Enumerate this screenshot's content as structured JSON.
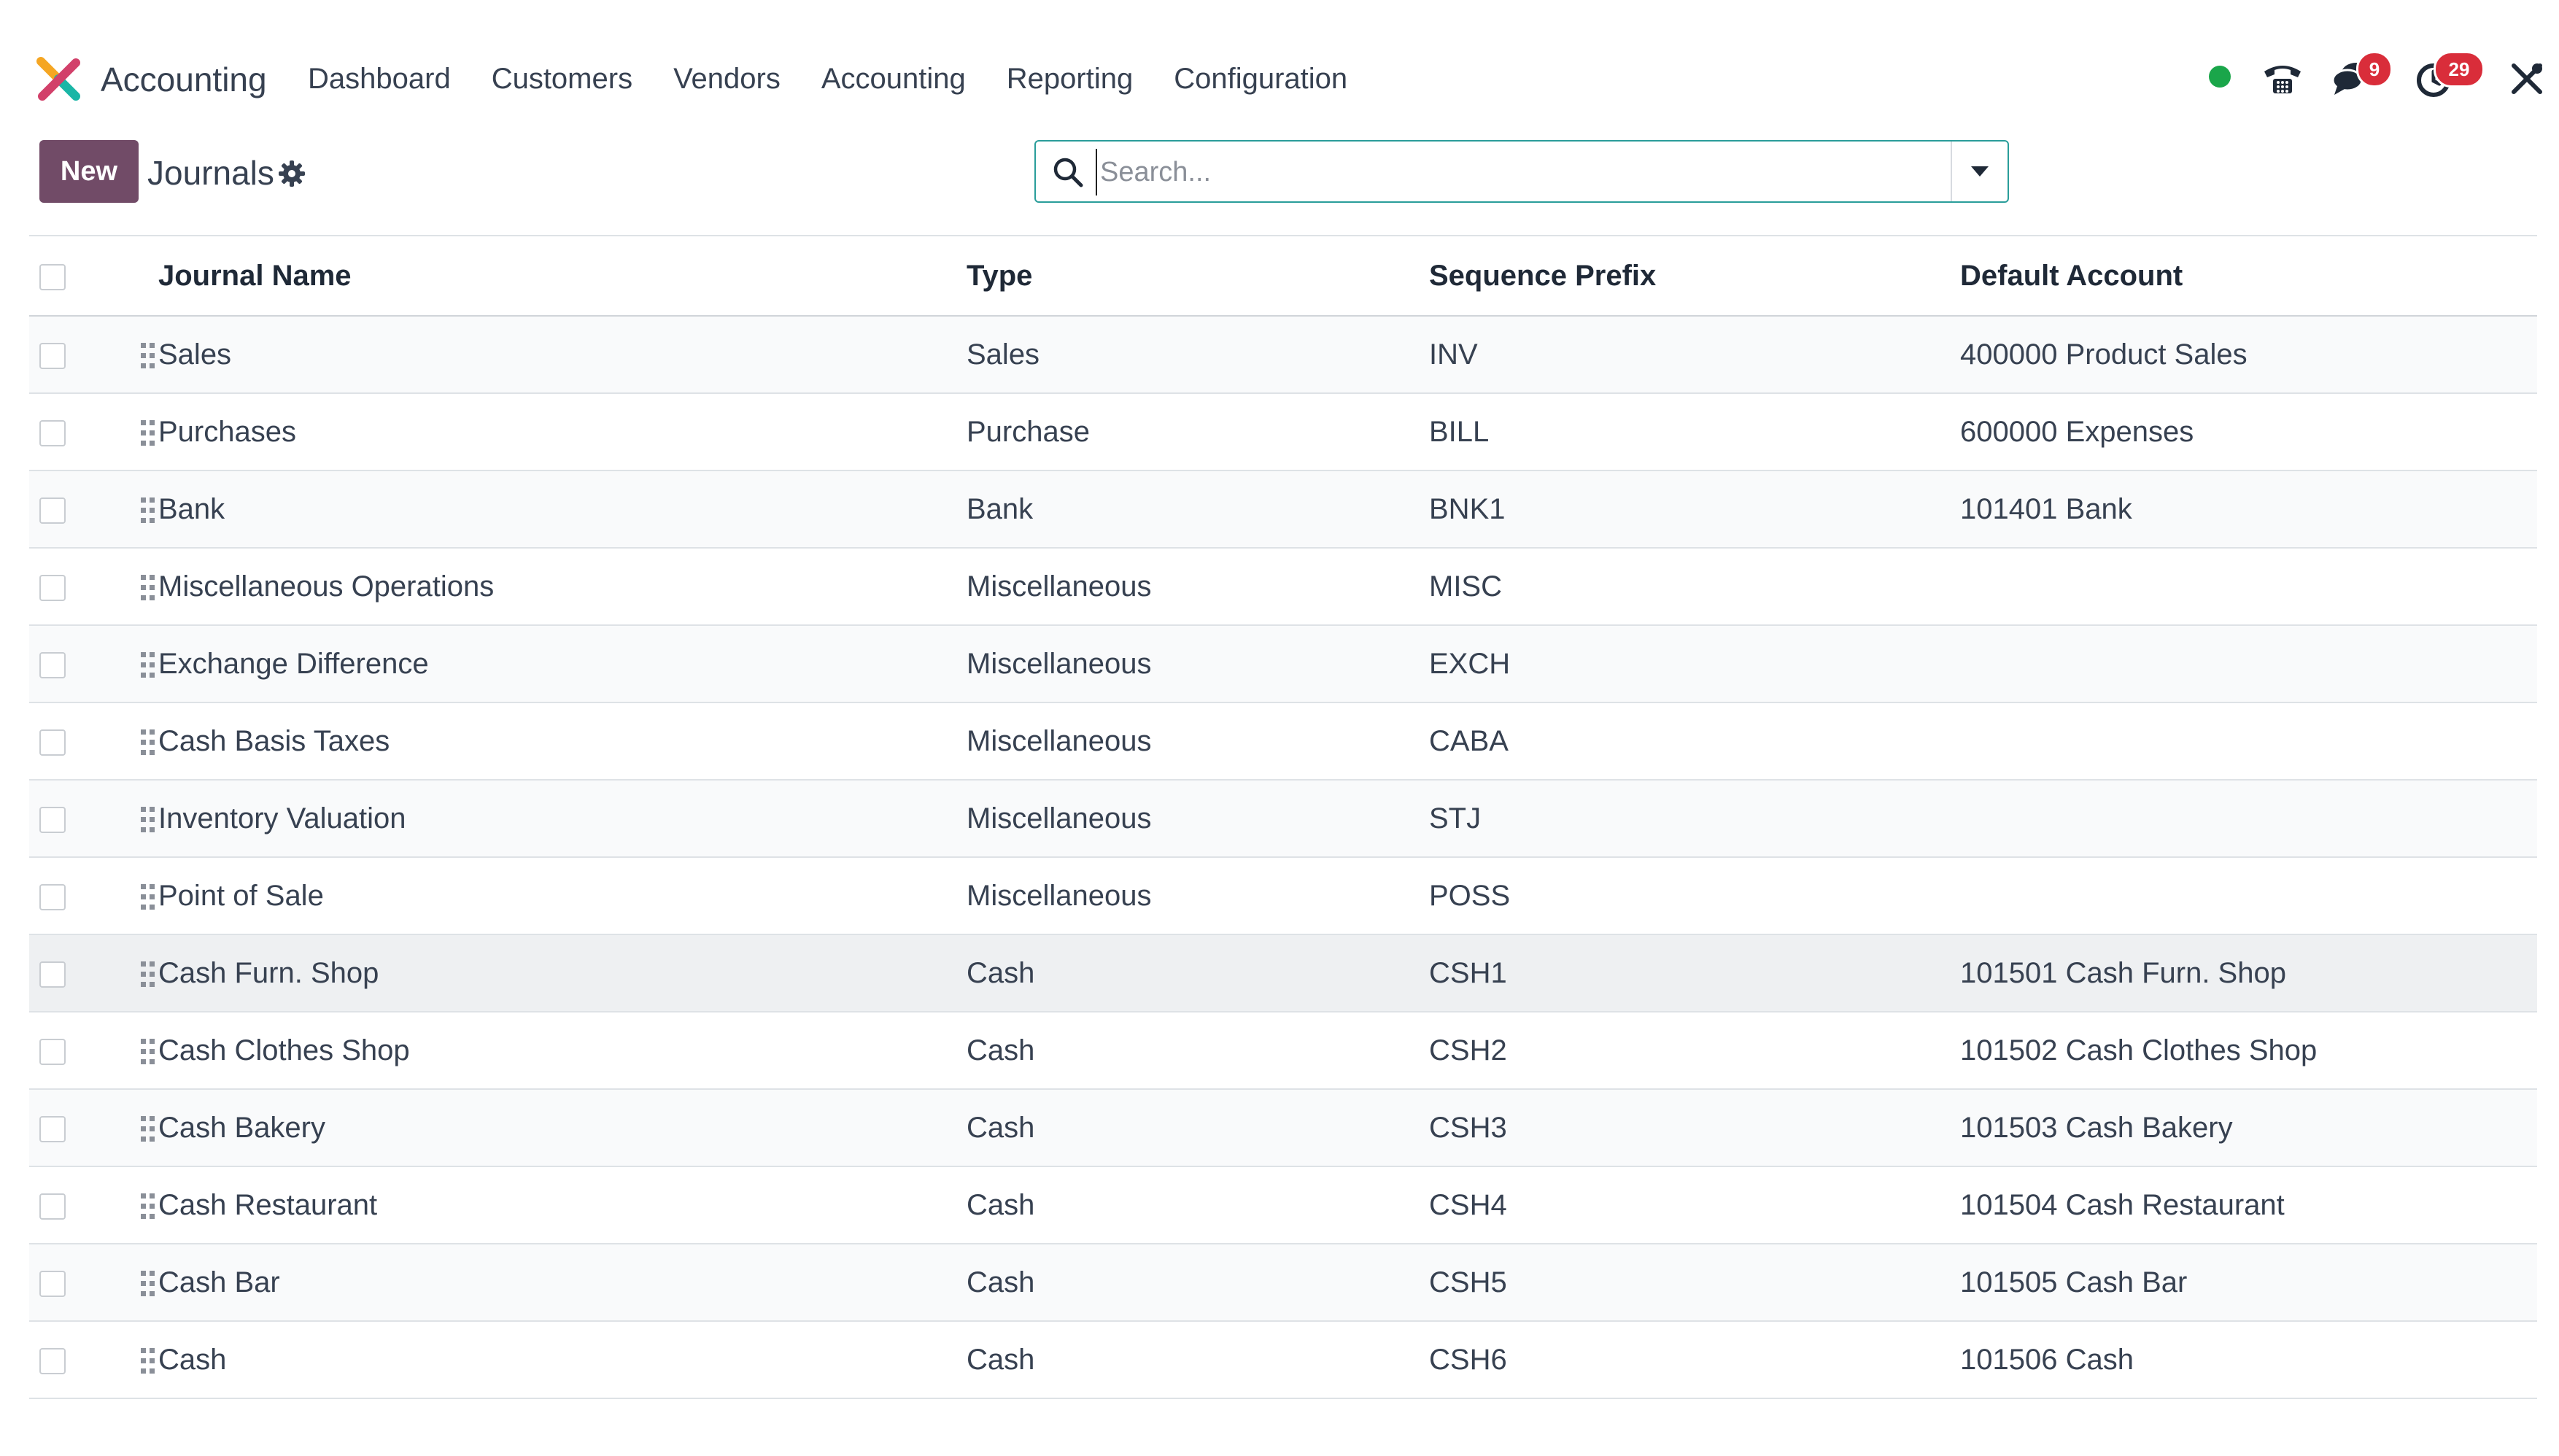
{
  "navbar": {
    "app_name": "Accounting",
    "menu": [
      "Dashboard",
      "Customers",
      "Vendors",
      "Accounting",
      "Reporting",
      "Configuration"
    ],
    "messages_count": "9",
    "activities_count": "29",
    "presence_color": "#1aa64a"
  },
  "control_panel": {
    "new_label": "New",
    "breadcrumb": "Journals",
    "search_placeholder": "Search..."
  },
  "table": {
    "columns": [
      "Journal Name",
      "Type",
      "Sequence Prefix",
      "Default Account"
    ],
    "rows": [
      {
        "name": "Sales",
        "type": "Sales",
        "prefix": "INV",
        "account": "400000 Product Sales"
      },
      {
        "name": "Purchases",
        "type": "Purchase",
        "prefix": "BILL",
        "account": "600000 Expenses"
      },
      {
        "name": "Bank",
        "type": "Bank",
        "prefix": "BNK1",
        "account": "101401 Bank"
      },
      {
        "name": "Miscellaneous Operations",
        "type": "Miscellaneous",
        "prefix": "MISC",
        "account": ""
      },
      {
        "name": "Exchange Difference",
        "type": "Miscellaneous",
        "prefix": "EXCH",
        "account": ""
      },
      {
        "name": "Cash Basis Taxes",
        "type": "Miscellaneous",
        "prefix": "CABA",
        "account": ""
      },
      {
        "name": "Inventory Valuation",
        "type": "Miscellaneous",
        "prefix": "STJ",
        "account": ""
      },
      {
        "name": "Point of Sale",
        "type": "Miscellaneous",
        "prefix": "POSS",
        "account": ""
      },
      {
        "name": "Cash Furn. Shop",
        "type": "Cash",
        "prefix": "CSH1",
        "account": "101501 Cash Furn. Shop"
      },
      {
        "name": "Cash Clothes Shop",
        "type": "Cash",
        "prefix": "CSH2",
        "account": "101502 Cash Clothes Shop"
      },
      {
        "name": "Cash Bakery",
        "type": "Cash",
        "prefix": "CSH3",
        "account": "101503 Cash Bakery"
      },
      {
        "name": "Cash Restaurant",
        "type": "Cash",
        "prefix": "CSH4",
        "account": "101504 Cash Restaurant"
      },
      {
        "name": "Cash Bar",
        "type": "Cash",
        "prefix": "CSH5",
        "account": "101505 Cash Bar"
      },
      {
        "name": "Cash",
        "type": "Cash",
        "prefix": "CSH6",
        "account": "101506 Cash"
      }
    ]
  },
  "colors": {
    "brand": "#714b67",
    "search_border": "#2a9d9a",
    "badge": "#d92d3a"
  }
}
